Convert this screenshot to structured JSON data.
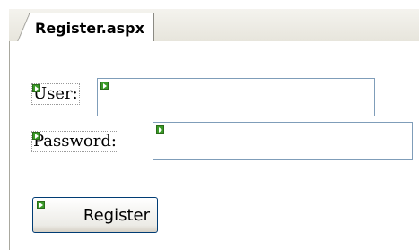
{
  "tab": {
    "label": "Register.aspx"
  },
  "form": {
    "user_label": "User:",
    "password_label": "Password:",
    "user_value": "",
    "password_value": "",
    "register_label": "Register"
  },
  "colors": {
    "marker_green": "#3a9a27",
    "textbox_border": "#7f9db9",
    "button_border": "#003c74"
  }
}
